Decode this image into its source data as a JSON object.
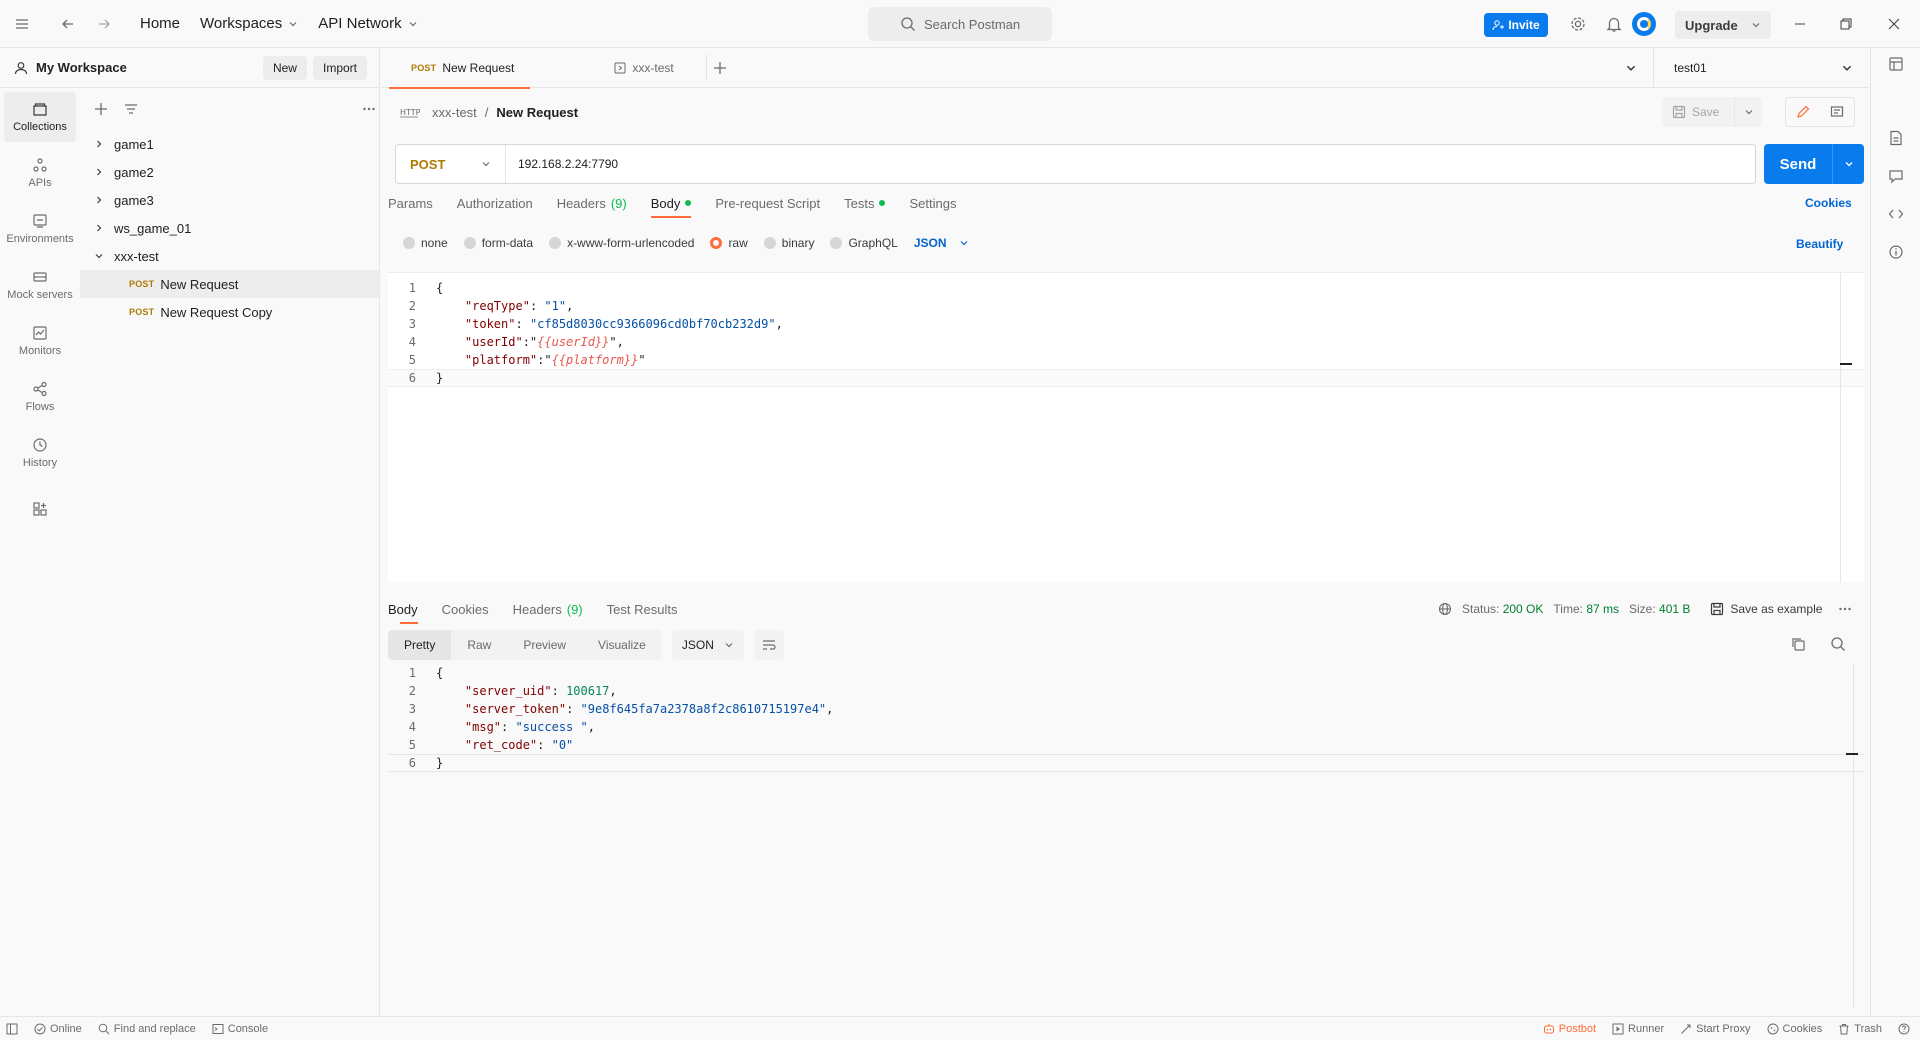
{
  "topbar": {
    "home": "Home",
    "workspaces": "Workspaces",
    "api_network": "API Network",
    "search_placeholder": "Search Postman",
    "invite": "Invite",
    "upgrade": "Upgrade"
  },
  "workspace": {
    "name": "My Workspace",
    "new_label": "New",
    "import_label": "Import"
  },
  "rail": [
    {
      "label": "Collections",
      "icon": "collections-icon"
    },
    {
      "label": "APIs",
      "icon": "apis-icon"
    },
    {
      "label": "Environments",
      "icon": "environments-icon"
    },
    {
      "label": "Mock servers",
      "icon": "mock-servers-icon"
    },
    {
      "label": "Monitors",
      "icon": "monitors-icon"
    },
    {
      "label": "Flows",
      "icon": "flows-icon"
    },
    {
      "label": "History",
      "icon": "history-icon"
    }
  ],
  "collections": [
    "game1",
    "game2",
    "game3",
    "ws_game_01",
    "xxx-test"
  ],
  "requests": [
    {
      "method": "POST",
      "name": "New Request"
    },
    {
      "method": "POST",
      "name": "New Request Copy"
    }
  ],
  "tabs": [
    {
      "method": "POST",
      "name": "New Request"
    },
    {
      "name": "xxx-test"
    }
  ],
  "environment": "test01",
  "breadcrumb": {
    "collection": "xxx-test",
    "request": "New Request"
  },
  "save_label": "Save",
  "request": {
    "method": "POST",
    "url": "192.168.2.24:7790",
    "send": "Send"
  },
  "req_tabs": {
    "params": "Params",
    "authorization": "Authorization",
    "headers": "Headers",
    "headers_count": "(9)",
    "body": "Body",
    "prerequest": "Pre-request Script",
    "tests": "Tests",
    "settings": "Settings",
    "cookies": "Cookies"
  },
  "body_types": {
    "none": "none",
    "form_data": "form-data",
    "urlencoded": "x-www-form-urlencoded",
    "raw": "raw",
    "binary": "binary",
    "graphql": "GraphQL",
    "format": "JSON",
    "beautify": "Beautify"
  },
  "request_body": {
    "reqType_key": "\"reqType\"",
    "reqType_val": "\"1\"",
    "token_key": "\"token\"",
    "token_val": "\"cf85d8030cc9366096cd0bf70cb232d9\"",
    "userId_key": "\"userId\"",
    "userId_val": "{{userId}}",
    "platform_key": "\"platform\"",
    "platform_val": "{{platform}}"
  },
  "resp_tabs": {
    "body": "Body",
    "cookies": "Cookies",
    "headers": "Headers",
    "headers_count": "(9)",
    "test_results": "Test Results"
  },
  "resp_meta": {
    "status_label": "Status:",
    "status": "200 OK",
    "time_label": "Time:",
    "time": "87 ms",
    "size_label": "Size:",
    "size": "401 B",
    "save_example": "Save as example"
  },
  "views": {
    "pretty": "Pretty",
    "raw": "Raw",
    "preview": "Preview",
    "visualize": "Visualize",
    "format": "JSON"
  },
  "response_body": {
    "uid_key": "\"server_uid\"",
    "uid_val": "100617",
    "token_key": "\"server_token\"",
    "token_val": "\"9e8f645fa7a2378a8f2c8610715197e4\"",
    "msg_key": "\"msg\"",
    "msg_val": "\"success \"",
    "ret_key": "\"ret_code\"",
    "ret_val": "\"0\""
  },
  "statusbar": {
    "online": "Online",
    "find_replace": "Find and replace",
    "console": "Console",
    "postbot": "Postbot",
    "runner": "Runner",
    "start_proxy": "Start Proxy",
    "cookies": "Cookies",
    "trash": "Trash"
  },
  "colors": {
    "accent": "#ff6c37",
    "primary": "#097bed",
    "post": "#ad7a03",
    "ok": "#007f31"
  }
}
